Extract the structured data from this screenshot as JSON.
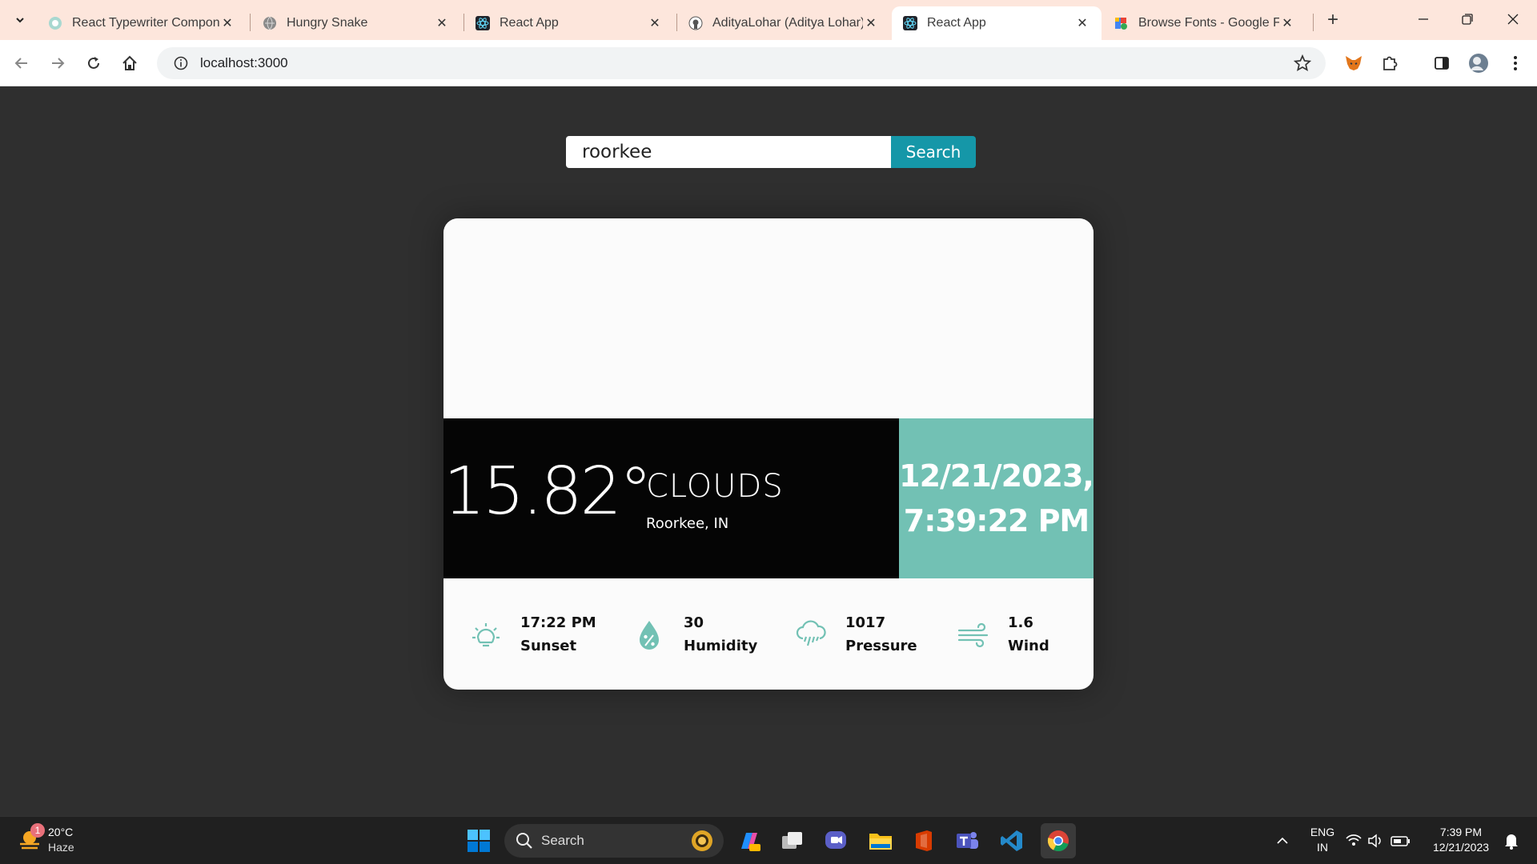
{
  "browser": {
    "tabs": [
      {
        "title": "React Typewriter Compone",
        "icon": "typewriter-favicon"
      },
      {
        "title": "Hungry Snake",
        "icon": "globe-favicon"
      },
      {
        "title": "React App",
        "icon": "react-favicon"
      },
      {
        "title": "AdityaLohar (Aditya Lohar)",
        "icon": "github-favicon"
      },
      {
        "title": "React App",
        "icon": "react-favicon",
        "active": true
      },
      {
        "title": "Browse Fonts - Google Fon",
        "icon": "google-fonts-favicon"
      }
    ],
    "url": "localhost:3000",
    "theme_color": "#fde6dc"
  },
  "search": {
    "value": "roorkee",
    "button_label": "Search",
    "button_color": "#1597a8"
  },
  "weather": {
    "temperature": "15.82°",
    "condition": "CLOUDS",
    "location": "Roorkee, IN",
    "date": "12/21/2023,",
    "time": "7:39:22 PM",
    "accent_color": "#72c1b4",
    "stats": [
      {
        "value": "17:22 PM",
        "label": "Sunset",
        "icon": "sunset-icon"
      },
      {
        "value": "30",
        "label": "Humidity",
        "icon": "humidity-icon"
      },
      {
        "value": "1017",
        "label": "Pressure",
        "icon": "rain-cloud-icon"
      },
      {
        "value": "1.6",
        "label": "Wind",
        "icon": "wind-icon"
      }
    ]
  },
  "taskbar": {
    "weather_temp": "20°C",
    "weather_desc": "Haze",
    "notification_count": "1",
    "search_label": "Search",
    "lang_top": "ENG",
    "lang_bottom": "IN",
    "clock_time": "7:39 PM",
    "clock_date": "12/21/2023"
  }
}
